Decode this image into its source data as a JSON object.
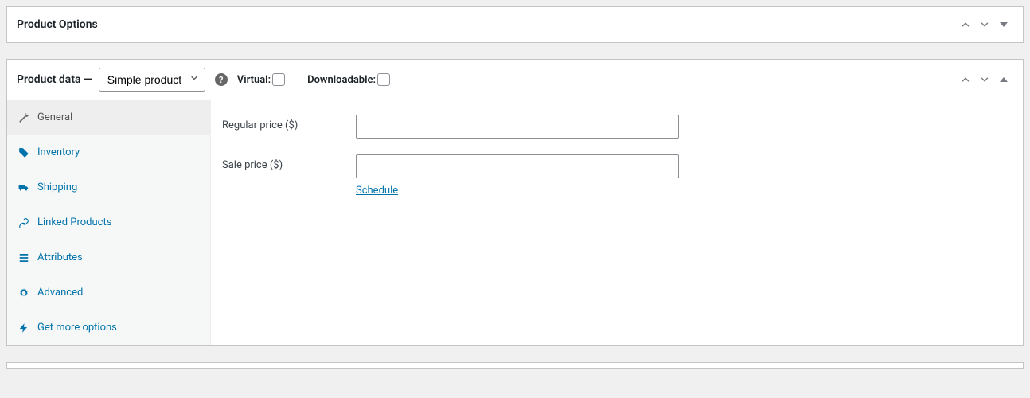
{
  "productOptions": {
    "title": "Product Options"
  },
  "productData": {
    "title": "Product data —",
    "typeSelected": "Simple product",
    "virtualLabel": "Virtual:",
    "downloadableLabel": "Downloadable:"
  },
  "tabs": [
    {
      "label": "General"
    },
    {
      "label": "Inventory"
    },
    {
      "label": "Shipping"
    },
    {
      "label": "Linked Products"
    },
    {
      "label": "Attributes"
    },
    {
      "label": "Advanced"
    },
    {
      "label": "Get more options"
    }
  ],
  "fields": {
    "regularPrice": {
      "label": "Regular price ($)",
      "value": ""
    },
    "salePrice": {
      "label": "Sale price ($)",
      "value": ""
    },
    "scheduleLabel": "Schedule"
  }
}
